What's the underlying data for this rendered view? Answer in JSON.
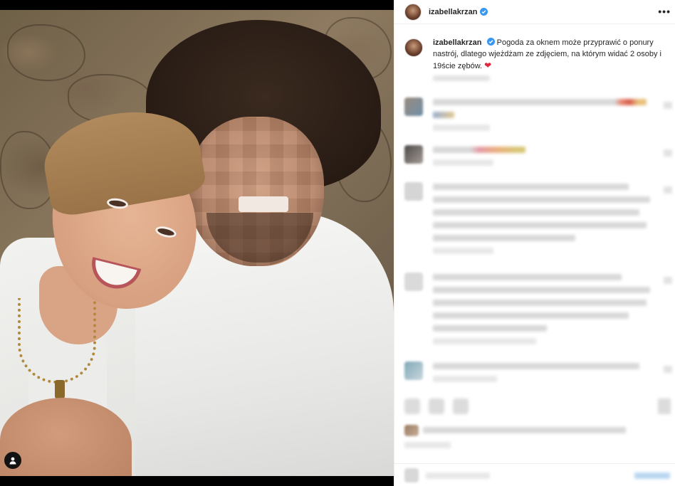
{
  "post": {
    "username": "izabellakrzan",
    "caption": "Pogoda za oknem może przyprawić o ponury nastrój, dlatego wjeżdżam ze zdjęciem, na którym widać 2 osoby i 19ście zębów.",
    "heart_glyph": "❤",
    "more_glyph": "•••"
  },
  "icons": {
    "verified": "verified-badge-icon",
    "user_tag": "user-tag-icon",
    "more": "more-options-icon"
  },
  "colors": {
    "verified_blue": "#3897f0",
    "heart_red": "#e0283c",
    "text": "#262626"
  }
}
